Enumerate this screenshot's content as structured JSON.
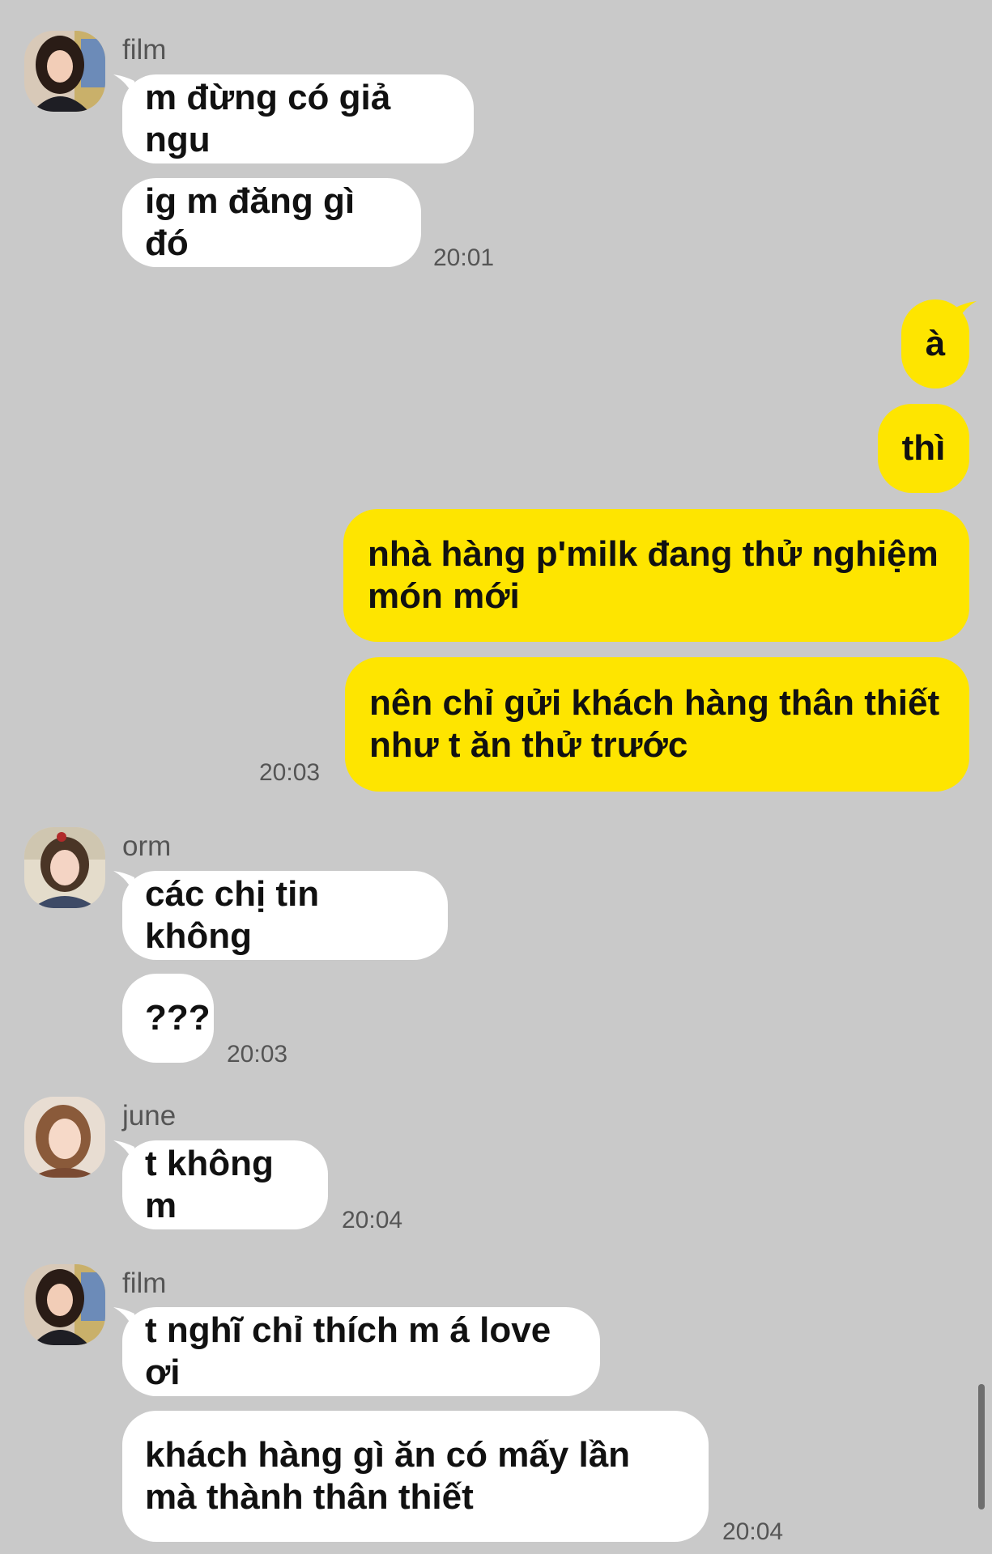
{
  "colors": {
    "background": "#c9c9c9",
    "incoming_bubble": "#ffffff",
    "outgoing_bubble": "#fee500",
    "meta_text": "#555555"
  },
  "groups": [
    {
      "sender": "film",
      "messages": [
        "m đừng có giả ngu",
        "ig m đăng gì đó"
      ],
      "time": "20:01"
    },
    {
      "sender": "",
      "outgoing": true,
      "messages": [
        "à",
        "thì",
        "nhà hàng p'milk đang thử nghiệm món mới",
        "nên chỉ gửi khách hàng thân thiết như t ăn thử trước"
      ],
      "time": "20:03"
    },
    {
      "sender": "orm",
      "messages": [
        "các chị tin không",
        "???"
      ],
      "time": "20:03"
    },
    {
      "sender": "june",
      "messages": [
        "t không m"
      ],
      "time": "20:04"
    },
    {
      "sender": "film",
      "messages": [
        "t nghĩ chỉ thích m á love ơi",
        "khách hàng gì ăn có mấy lần mà thành thân thiết"
      ],
      "time": "20:04"
    }
  ]
}
